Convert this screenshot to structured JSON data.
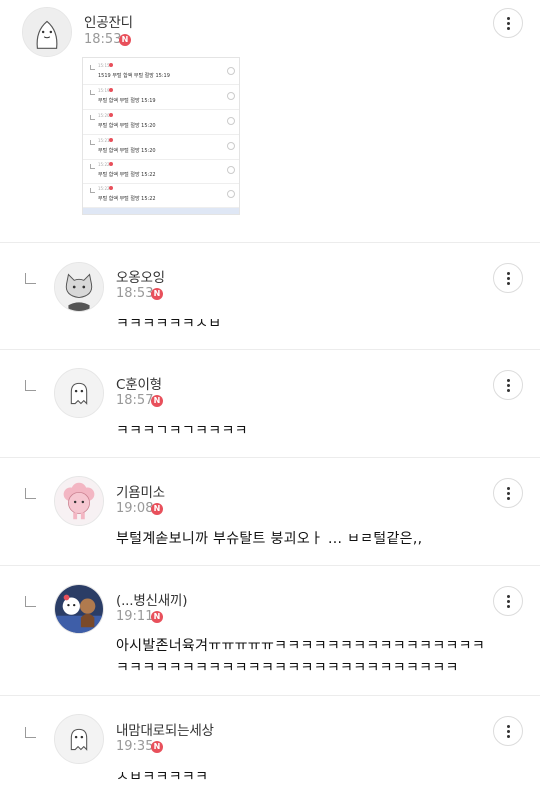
{
  "badge_label": "N",
  "top_post": {
    "author": "인공잔디",
    "time": "18:53",
    "thumbnail": {
      "rows": [
        {
          "time": "15:15",
          "text": "1519  부털 합액 부털 절망 15:19"
        },
        {
          "time": "15:19",
          "text": "부털 합액 부털 절망 15:19"
        },
        {
          "time": "15:20",
          "text": "부털 합액 부털 절망 15:20"
        },
        {
          "time": "15:21",
          "text": "부털 합액 부털 절망 15:20"
        },
        {
          "time": "15:22",
          "text": "부털 합액 부털 절망 15:22"
        },
        {
          "time": "15:22",
          "text": "부털 합액 부털 절망 15:22"
        }
      ]
    }
  },
  "comments": [
    {
      "author": "오옹오잉",
      "time": "18:53",
      "lines": [
        "ㅋㅋㅋㅋㅋㅋㅅㅂ"
      ],
      "avatar": "cat-avatar"
    },
    {
      "author": "C훈이형",
      "time": "18:57",
      "lines": [
        "ㅋㅋㅋㄱㅋㄱㅋㅋㅋㅋ"
      ],
      "avatar": "ghost-avatar"
    },
    {
      "author": "기욤미소",
      "time": "19:08",
      "lines": [
        "부털계솓보니까 부슈탈트 붕괴오ㅏ ... ㅂㄹ털같은,,"
      ],
      "avatar": "pink-sheep-avatar"
    },
    {
      "author": "(...병신새끼)",
      "time": "19:11",
      "lines": [
        "아시발존너육겨ㅠㅠㅠㅠㅠㅋㅋㅋㅋㅋㅋㅋㅋㅋㅋㅋㅋㅋㅋㅋㅋ",
        "ㅋㅋㅋㅋㅋㅋㅋㅋㅋㅋㅋㅋㅋㅋㅋㅋㅋㅋㅋㅋㅋㅋㅋㅋㅋㅋ"
      ],
      "avatar": "photo-avatar"
    },
    {
      "author": "내맘대로되는세상",
      "time": "19:35",
      "lines": [
        "ㅅㅂㅋㅋㅋㅋㅋ"
      ],
      "avatar": "ghost-avatar"
    }
  ]
}
